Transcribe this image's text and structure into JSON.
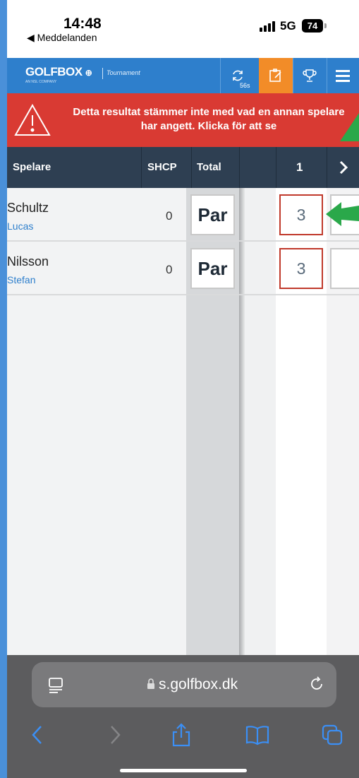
{
  "status_bar": {
    "time": "14:48",
    "back_app": "◀ Meddelanden",
    "network": "5G",
    "battery": "74"
  },
  "header": {
    "logo": "GOLFBOX",
    "logo_sub": "AN NSL COMPANY",
    "logo_tournament": "Tournament",
    "sync_count": "56s",
    "icons": [
      "sync-icon",
      "scorecard-edit-icon",
      "trophy-icon",
      "menu-icon"
    ],
    "accent_color": "#2e7fcc",
    "active_color": "#f28c28"
  },
  "alert": {
    "message": "Detta resultat stämmer inte med vad en annan spelare har angett. Klicka för att se",
    "color": "#d93a33"
  },
  "table": {
    "headers": {
      "player": "Spelare",
      "shcp": "SHCP",
      "total": "Total",
      "hole": "1",
      "next": "›"
    },
    "rows": [
      {
        "last_name": "Schultz",
        "first_name": "Lucas",
        "shcp": "0",
        "total": "Par",
        "hole1": "3"
      },
      {
        "last_name": "Nilsson",
        "first_name": "Stefan",
        "shcp": "0",
        "total": "Par",
        "hole1": "3"
      }
    ]
  },
  "browser": {
    "url": "s.golfbox.dk",
    "nav_icons": [
      "back-icon",
      "forward-icon",
      "share-icon",
      "bookmarks-icon",
      "tabs-icon"
    ]
  }
}
